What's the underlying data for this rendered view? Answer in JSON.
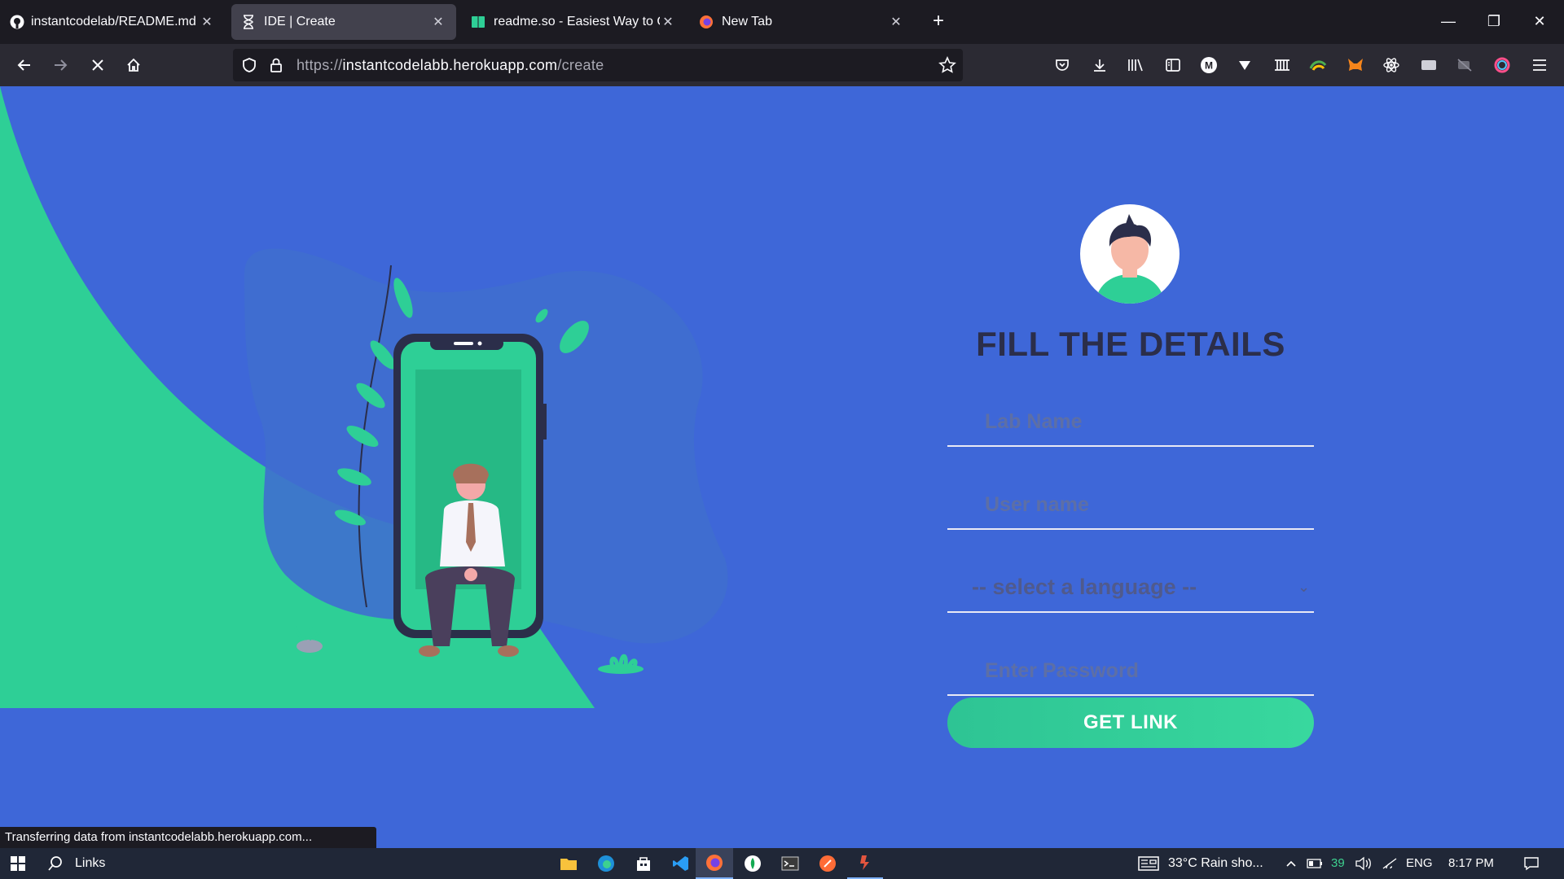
{
  "browser": {
    "tabs": [
      {
        "label": "instantcodelab/README.md a",
        "icon": "github-icon",
        "active": false
      },
      {
        "label": "IDE | Create",
        "icon": "hourglass-icon",
        "active": true
      },
      {
        "label": "readme.so - Easiest Way to Cr",
        "icon": "book-icon",
        "active": false
      },
      {
        "label": "New Tab",
        "icon": "firefox-icon",
        "active": false
      }
    ],
    "url_prefix": "https://",
    "url_host": "instantcodelabb.herokuapp.com",
    "url_path": "/create",
    "status_text": "Transferring data from instantcodelabb.herokuapp.com..."
  },
  "form": {
    "title": "FILL THE DETAILS",
    "lab_name_placeholder": "Lab Name",
    "username_placeholder": "User name",
    "language_select": "-- select a language --",
    "password_placeholder": "Enter Password",
    "submit_label": "GET LINK"
  },
  "taskbar": {
    "search_label": "Links",
    "weather": "33°C  Rain sho...",
    "battery_level": "39",
    "language": "ENG",
    "time": "8:17 PM"
  },
  "colors": {
    "page_bg": "#3e67d8",
    "accent_green": "#2ecf96",
    "title_color": "#2b2e4a"
  }
}
